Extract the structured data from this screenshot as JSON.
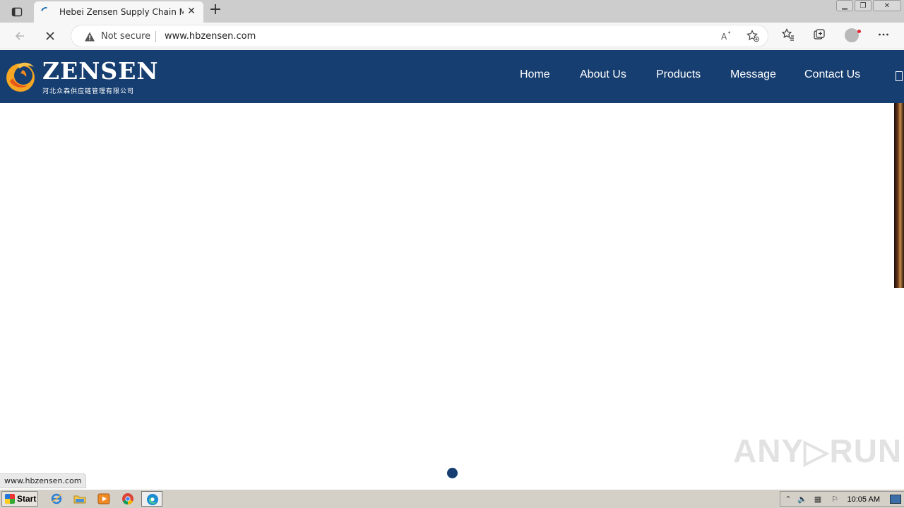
{
  "browser": {
    "tab_title": "Hebei Zensen Supply Chain Man",
    "tab_close_glyph": "✕",
    "new_tab_glyph": "+",
    "security_label": "Not secure",
    "url": "www.hbzensen.com",
    "window_controls": [
      "▁",
      "❐",
      "✕"
    ]
  },
  "site": {
    "logo_text": "ZENSEN",
    "logo_subtitle": "河北众森供应链管理有限公司",
    "nav": [
      "Home",
      "About Us",
      "Products",
      "Message",
      "Contact Us"
    ]
  },
  "status_bar": {
    "url": "www.hbzensen.com"
  },
  "watermark": "ANY▷RUN",
  "taskbar": {
    "start_label": "Start",
    "clock": "10:05 AM"
  },
  "colors": {
    "header_bg": "#163e70",
    "accent_orange": "#f0a020"
  }
}
